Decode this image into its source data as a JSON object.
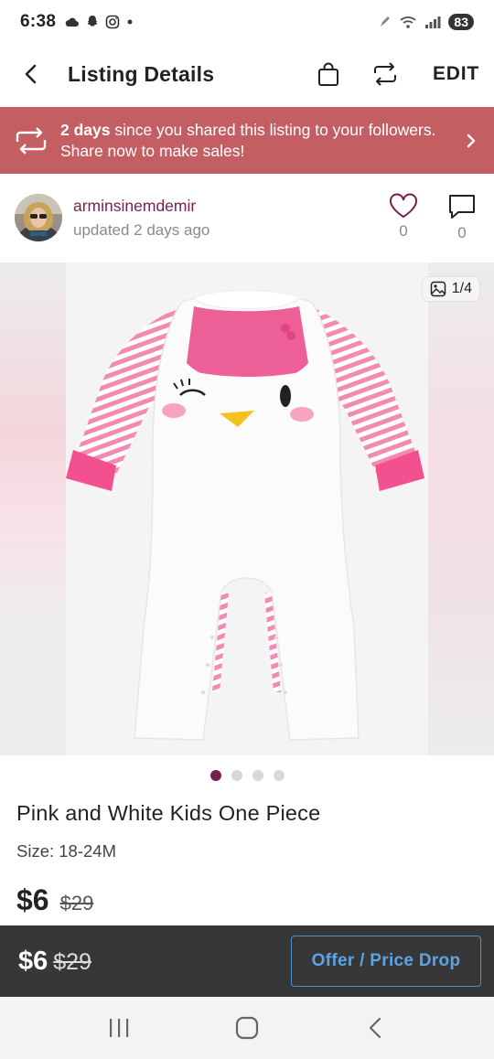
{
  "status_bar": {
    "time": "6:38",
    "battery": "83",
    "icons": [
      "cloud-icon",
      "snapchat-icon",
      "instagram-icon",
      "dot-icon",
      "pen-icon",
      "wifi-icon",
      "signal-icon",
      "battery-icon"
    ]
  },
  "header": {
    "title": "Listing Details",
    "edit_label": "EDIT",
    "icons": [
      "back-chevron-icon",
      "shopping-bag-icon",
      "share-repost-icon"
    ]
  },
  "banner": {
    "bold_text": "2 days",
    "text": " since you shared this listing to your followers. Share now to make sales!",
    "bg_color": "#c35f62"
  },
  "seller": {
    "username": "arminsinemdemir",
    "updated": "updated 2 days ago",
    "likes": "0",
    "comments": "0"
  },
  "image": {
    "counter": "1/4",
    "total_pages": 4,
    "active_page": 1
  },
  "product": {
    "title": "Pink and White Kids One Piece",
    "size": "Size: 18-24M",
    "price": "$6",
    "original_price": "$29"
  },
  "action_bar": {
    "price": "$6",
    "original_price": "$29",
    "offer_label": "Offer / Price Drop"
  },
  "colors": {
    "brand": "#7a1f4f",
    "banner": "#c35f62",
    "action_bar": "#373737",
    "offer_blue": "#5aa4e8"
  }
}
